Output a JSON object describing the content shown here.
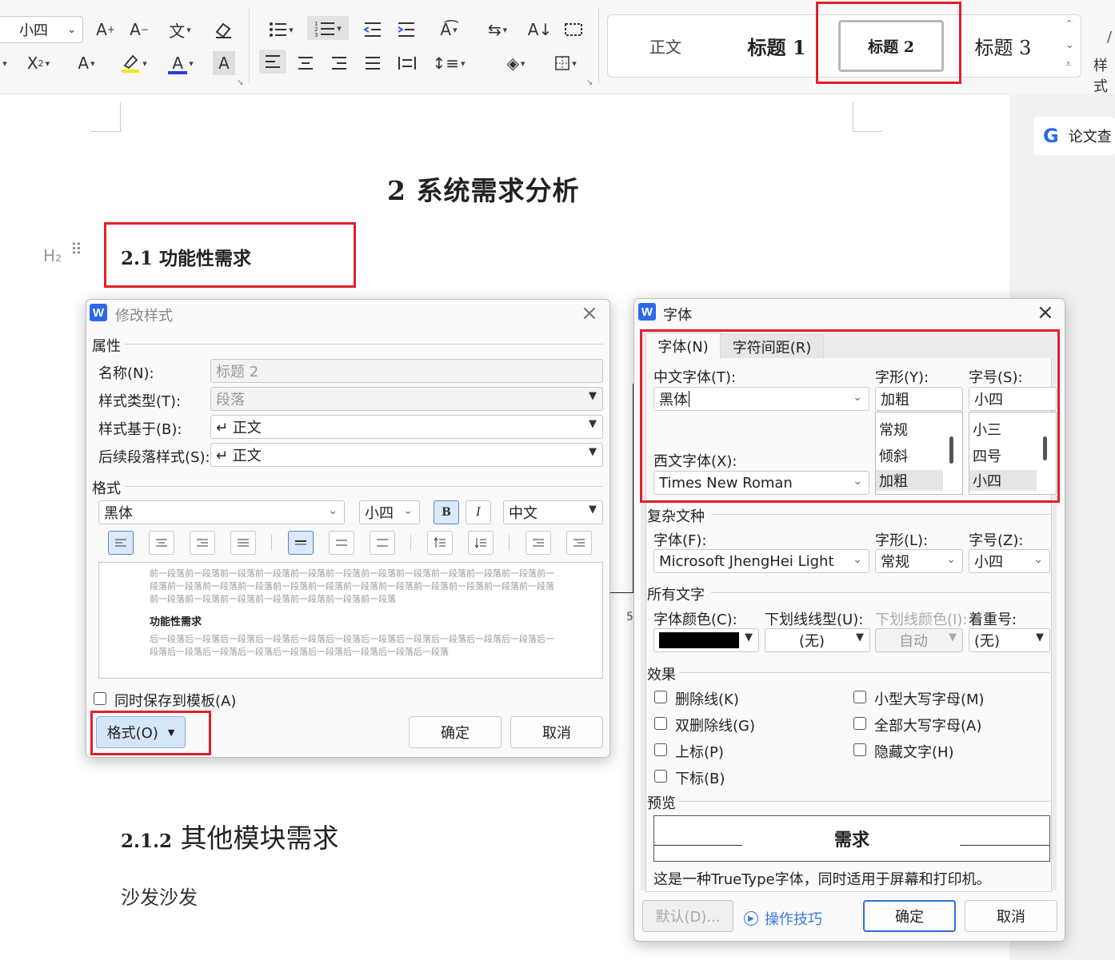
{
  "ribbon": {
    "font_size": "小四",
    "styles": [
      "正文",
      "标题 1",
      "标题 2",
      "标题 3"
    ],
    "styles_more": "样式",
    "icons": [
      "grow-font",
      "shrink-font",
      "phonetic",
      "clear-format",
      "bullets",
      "numbering",
      "decrease-indent",
      "increase-indent",
      "text-direction",
      "sort",
      "line-spacing",
      "borders",
      "superscript",
      "text-effects",
      "highlight",
      "font-color",
      "char-shading",
      "align-left",
      "align-center",
      "align-right",
      "justify",
      "distribute",
      "line-spacing",
      "shading",
      "table-border"
    ]
  },
  "side": {
    "paper_check": "论文查"
  },
  "doc": {
    "title": "2  系统需求分析",
    "heading2": "2.1  功能性需求",
    "h2_marker": "H₂",
    "heading3_num": "2.1.2",
    "heading3_text": "其他模块需求",
    "body": "沙发沙发",
    "left_num": "5"
  },
  "modify": {
    "title": "修改样式",
    "props_section": "属性",
    "name_label": "名称(N):",
    "name_value": "标题 2",
    "type_label": "样式类型(T):",
    "type_value": "段落",
    "based_label": "样式基于(B):",
    "based_value": "↵ 正文",
    "next_label": "后续段落样式(S):",
    "next_value": "↵ 正文",
    "format_section": "格式",
    "font": "黑体",
    "size": "小四",
    "bold": "B",
    "italic": "I",
    "lang": "中文",
    "preview_before": "前一段落前一段落前一段落前一段落前一段落前一段落前一段落前一段落前一段落前一段落",
    "preview_sample": "功能性需求",
    "preview_after": "后一段落后一段落后一段落后一段落后一段落后一段落后一段落后一段落后一段落后一段落",
    "save_template": "同时保存到模板(A)",
    "format_btn": "格式(O)",
    "ok": "确定",
    "cancel": "取消"
  },
  "fontdlg": {
    "title": "字体",
    "tab1": "字体(N)",
    "tab2": "字符间距(R)",
    "cn_font_label": "中文字体(T):",
    "cn_font": "黑体",
    "style_label": "字形(Y):",
    "style_value": "加粗",
    "style_list": [
      "常规",
      "倾斜",
      "加粗"
    ],
    "size_label": "字号(S):",
    "size_value": "小四",
    "size_list": [
      "小三",
      "四号",
      "小四"
    ],
    "west_font_label": "西文字体(X):",
    "west_font": "Times New Roman",
    "complex_section": "复杂文种",
    "cx_font_label": "字体(F):",
    "cx_font": "Microsoft JhengHei Light",
    "cx_style_label": "字形(L):",
    "cx_style": "常规",
    "cx_size_label": "字号(Z):",
    "cx_size": "小四",
    "all_section": "所有文字",
    "color_label": "字体颜色(C):",
    "color_value": "#000000",
    "underline_label": "下划线线型(U):",
    "underline_value": "(无)",
    "ucolor_label": "下划线颜色(I):",
    "ucolor_value": "自动",
    "emph_label": "着重号:",
    "emph_value": "(无)",
    "effects_section": "效果",
    "effects": [
      "删除线(K)",
      "小型大写字母(M)",
      "双删除线(G)",
      "全部大写字母(A)",
      "上标(P)",
      "隐藏文字(H)",
      "下标(B)"
    ],
    "preview_section": "预览",
    "preview_text": "需求",
    "note": "这是一种TrueType字体，同时适用于屏幕和打印机。",
    "default_btn": "默认(D)...",
    "tips": "操作技巧",
    "ok": "确定",
    "cancel": "取消"
  },
  "colors": {
    "highlight_red": "#e0202a",
    "accent_blue": "#2b6ae6",
    "ok_border": "#2f6fd6"
  }
}
